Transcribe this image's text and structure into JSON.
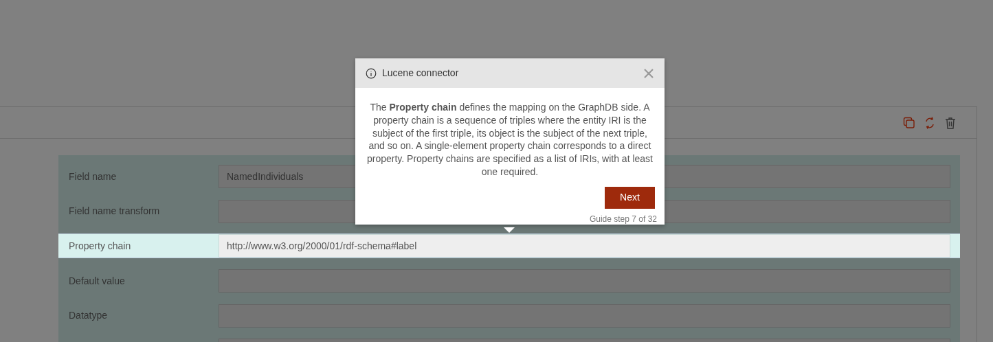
{
  "toolbar": {
    "buttons": [
      {
        "kind": "copy"
      },
      {
        "kind": "restart"
      },
      {
        "kind": "delete"
      }
    ]
  },
  "fields": [
    {
      "label": "Field name",
      "value": "NamedIndividuals",
      "highlighted": false
    },
    {
      "label": "Field name transform",
      "highlighted": false
    },
    {
      "label": "Property chain",
      "value": "http://www.w3.org/2000/01/rdf-schema#label",
      "highlighted": true
    },
    {
      "label": "Default value",
      "highlighted": false
    },
    {
      "label": "Datatype",
      "highlighted": false
    },
    {
      "highlighted": false
    }
  ],
  "guide": {
    "title": "Lucene connector",
    "text": "The **Property chain** defines the mapping on the GraphDB side. A property chain is a sequence of triples where the entity IRI is the subject of the first triple, its object is the subject of the next triple, and so on. A single-element property chain corresponds to a direct property. Property chains are specified as a list of IRIs, with at least one required.",
    "button": "Next",
    "step": "Guide step 7 of 32"
  }
}
